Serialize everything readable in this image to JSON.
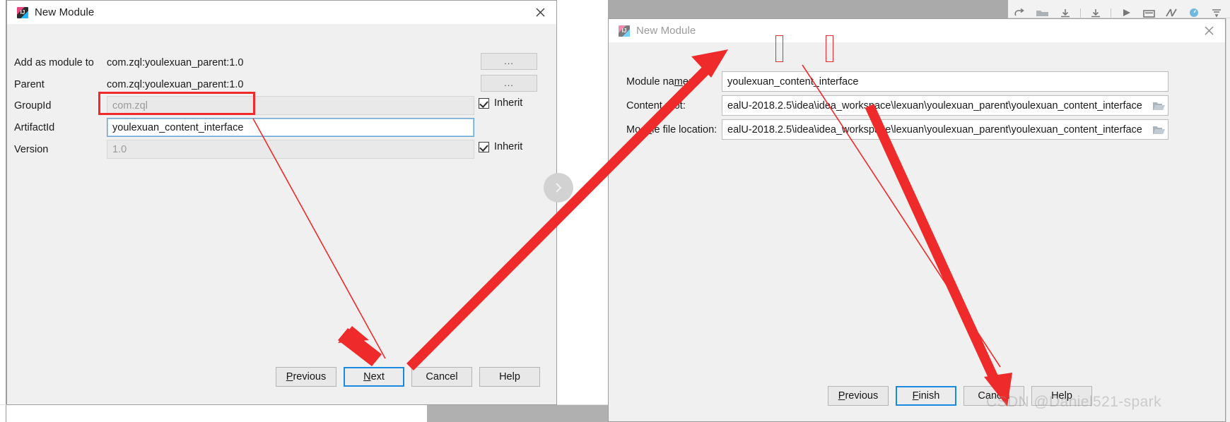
{
  "colors": {
    "annotation_red": "#ef2a2a",
    "focus_blue": "#1a8ae0",
    "field_focus_border": "#6aa5d8",
    "dialog_bg": "#f0f0f0",
    "ide_titlebar_gray": "#aaaaaa"
  },
  "ide": {
    "toolbar_icons": [
      "undo-icon",
      "open-folder-icon",
      "save-all-icon",
      "separator",
      "sync-icon",
      "separator",
      "run-icon",
      "stop-icon",
      "build-icon",
      "search-icon",
      "update-icon"
    ]
  },
  "left_dialog": {
    "title": "New Module",
    "close_label": "✕",
    "rows": [
      {
        "label": "Add as module to",
        "value": "com.zql:youlexuan_parent:1.0",
        "type": "static"
      },
      {
        "label": "Parent",
        "value": "com.zql:youlexuan_parent:1.0",
        "type": "static"
      },
      {
        "label": "GroupId",
        "value": "com.zql",
        "type": "field-disabled"
      },
      {
        "label": "ArtifactId",
        "value": "youlexuan_content_interface",
        "type": "field-focused"
      },
      {
        "label": "Version",
        "value": "1.0",
        "type": "field-disabled"
      }
    ],
    "dots_buttons": [
      {
        "name": "add-as-module-to-browse-button",
        "label": "..."
      },
      {
        "name": "parent-browse-button",
        "label": "..."
      }
    ],
    "inherit_checkboxes": [
      {
        "label": "Inherit",
        "checked": true
      },
      {
        "label": "Inherit",
        "checked": true
      }
    ],
    "next_circle_icon": "chevron-right-icon",
    "buttons": [
      {
        "label": "Previous",
        "mnemonic": "P",
        "default": false
      },
      {
        "label": "Next",
        "mnemonic": "N",
        "default": true
      },
      {
        "label": "Cancel",
        "mnemonic": "",
        "default": false
      },
      {
        "label": "Help",
        "mnemonic": "",
        "default": false
      }
    ]
  },
  "right_dialog": {
    "title": "New Module",
    "close_label": "✕",
    "fields": [
      {
        "label_pre": "Module na",
        "label_mnem": "m",
        "label_post": "e:",
        "value": "youlexuan_content_interface",
        "has_browse": false,
        "name": "module-name"
      },
      {
        "label_pre": "Content ",
        "label_mnem": "r",
        "label_post": "oot:",
        "value": "ealU-2018.2.5\\idea\\idea_workspace\\lexuan\\youlexuan_parent\\youlexuan_content_interface",
        "has_browse": true,
        "name": "content-root"
      },
      {
        "label_pre": "Mod",
        "label_mnem": "u",
        "label_post": "le file location:",
        "value": "ealU-2018.2.5\\idea\\idea_workspace\\lexuan\\youlexuan_parent\\youlexuan_content_interface",
        "has_browse": true,
        "name": "module-file-location"
      }
    ],
    "browse_icon": "folder-icon",
    "buttons": [
      {
        "label": "Previous",
        "mnemonic": "P",
        "default": false
      },
      {
        "label": "Finish",
        "mnemonic": "F",
        "default": true
      },
      {
        "label": "Cancel",
        "mnemonic": "",
        "default": false
      },
      {
        "label": "Help",
        "mnemonic": "",
        "default": false
      }
    ]
  },
  "watermark": "CSDN @Daniel521-spark",
  "annotations": {
    "artifact_id_box": "red rectangle around ArtifactId input",
    "underscore_marks": 2,
    "arrows": 3
  }
}
